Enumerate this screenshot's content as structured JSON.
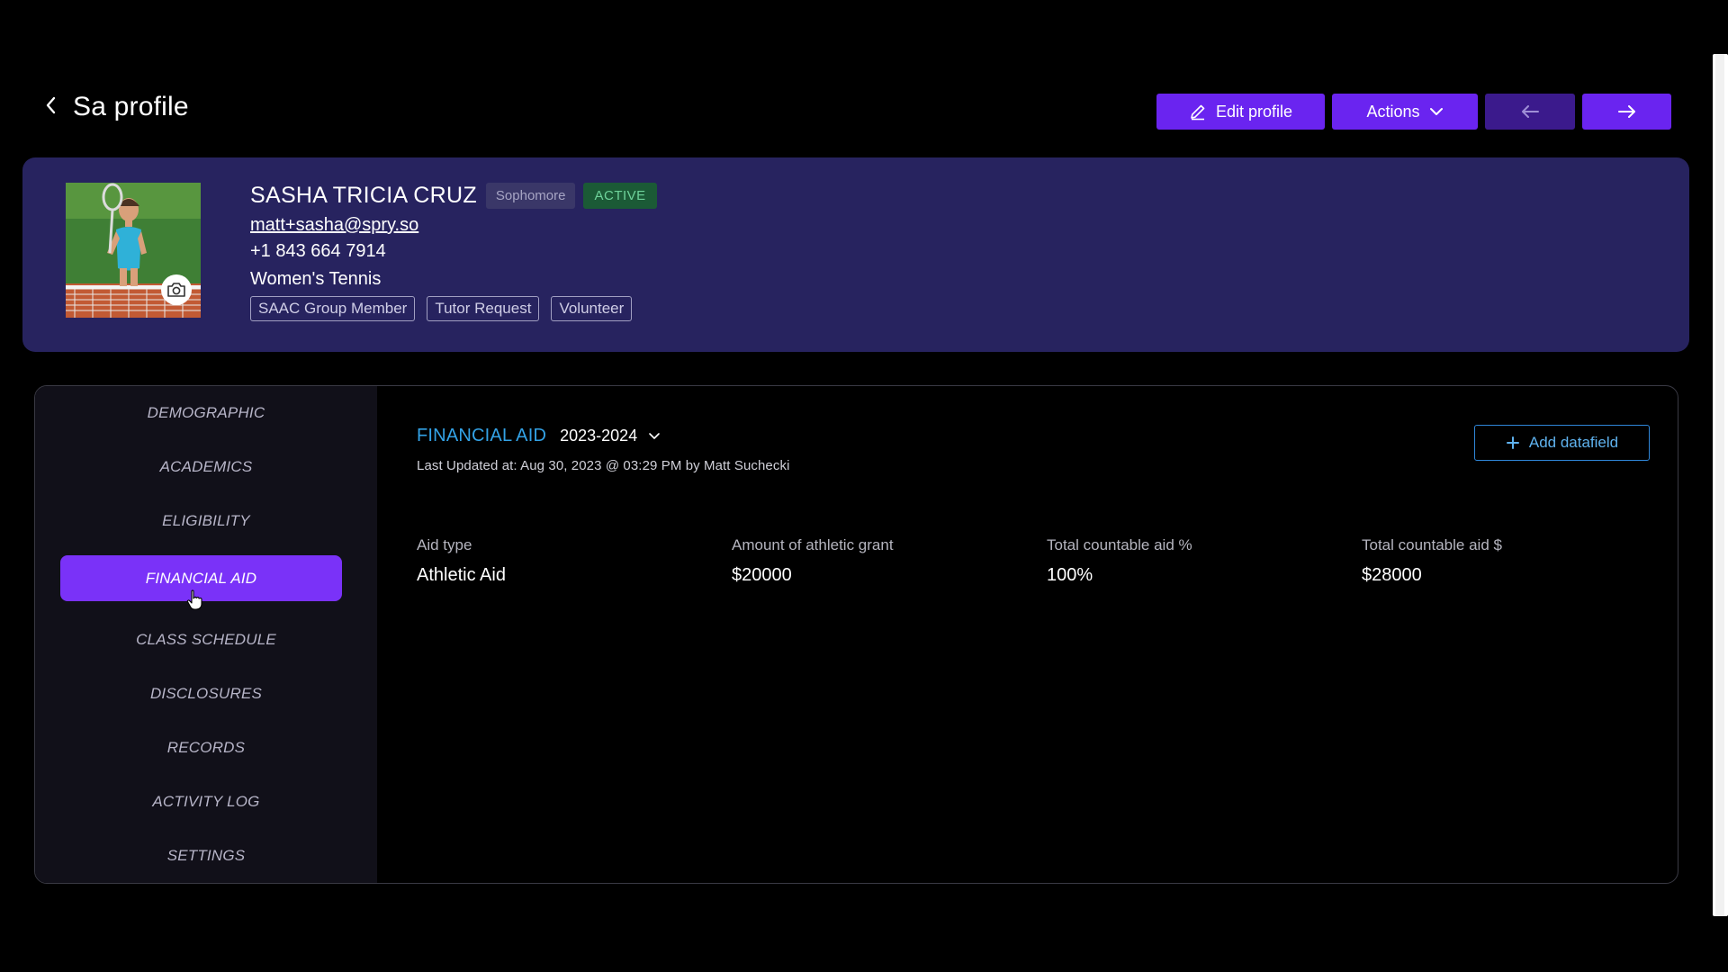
{
  "header": {
    "title": "Sa profile",
    "edit_label": "Edit profile",
    "actions_label": "Actions"
  },
  "profile": {
    "name": "SASHA TRICIA CRUZ",
    "class_year": "Sophomore",
    "status": "ACTIVE",
    "email": "matt+sasha@spry.so",
    "phone": "+1 843 664 7914",
    "sport": "Women's Tennis",
    "tags": [
      "SAAC Group Member",
      "Tutor Request",
      "Volunteer"
    ]
  },
  "sidebar": {
    "items": [
      {
        "label": "DEMOGRAPHIC",
        "active": false
      },
      {
        "label": "ACADEMICS",
        "active": false
      },
      {
        "label": "ELIGIBILITY",
        "active": false
      },
      {
        "label": "FINANCIAL AID",
        "active": true
      },
      {
        "label": "CLASS SCHEDULE",
        "active": false
      },
      {
        "label": "DISCLOSURES",
        "active": false
      },
      {
        "label": "RECORDS",
        "active": false
      },
      {
        "label": "ACTIVITY LOG",
        "active": false
      },
      {
        "label": "SETTINGS",
        "active": false
      }
    ]
  },
  "content": {
    "section_title": "FINANCIAL AID",
    "year": "2023-2024",
    "last_updated": "Last Updated at: Aug 30, 2023 @ 03:29 PM by Matt Suchecki",
    "add_label": "Add datafield",
    "fields": [
      {
        "label": "Aid type",
        "value": "Athletic Aid"
      },
      {
        "label": "Amount of athletic grant",
        "value": "$20000"
      },
      {
        "label": "Total countable aid %",
        "value": "100%"
      },
      {
        "label": "Total countable aid $",
        "value": "$28000"
      }
    ]
  },
  "colors": {
    "accent": "#6a24f0",
    "active_nav": "#7a32f8",
    "profile_card": "#27235f",
    "section_title": "#33a2e6",
    "status_green": "#6ed29a"
  },
  "icons": [
    "chevron-left-icon",
    "pencil-icon",
    "chevron-down-icon",
    "arrow-left-icon",
    "arrow-right-icon",
    "camera-icon",
    "plus-icon",
    "pointer-cursor-icon"
  ]
}
